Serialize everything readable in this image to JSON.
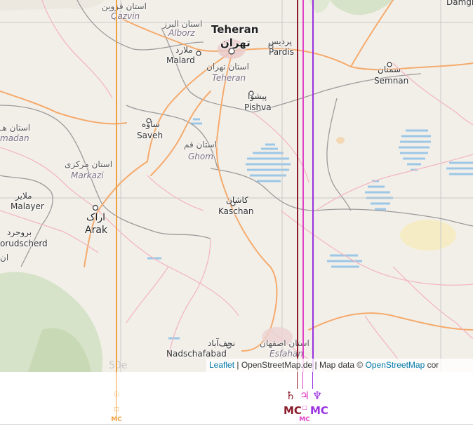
{
  "map": {
    "attribution": {
      "leaflet_link": "Leaflet",
      "sep": " | ",
      "tiles_text": "OpenStreetMap.de | Map data © ",
      "osm_link": "OpenStreetMap",
      "tail": " cor"
    },
    "grid_label": "50e",
    "places": {
      "damghan": "Damgh",
      "qazvin_fa": "استان قزوین",
      "qazvin": "Qazvin",
      "alborz_fa": "استان البرز",
      "alborz": "Alborz",
      "teheran_city": "Teheran",
      "tehran_fa": "تهران",
      "pardis_fa": "پردیس",
      "pardis": "Pardis",
      "malard_fa": "ملارد",
      "malard": "Malard",
      "tehran_prov_fa": "استان تهران",
      "teheran_prov": "Teheran",
      "semnan_fa": "سمنان",
      "semnan": "Semnan",
      "pishva_fa": "پیشوا",
      "pishva": "Pishva",
      "hamadan_fa": "استان هـ",
      "hamadan": "madan",
      "saveh_fa": "ساوه",
      "saveh": "Saveh",
      "qom_fa": "استان قم",
      "ghom": "Ghom",
      "markazi_fa": "استان مرکزی",
      "markazi": "Markazi",
      "kashan_fa": "کاشان",
      "kaschan": "Kaschan",
      "malayer_fa": "ملایر",
      "malayer": "Malayer",
      "arak_fa": "اراک",
      "arak": "Arak",
      "borujerd_fa": "بروجرد",
      "borujerd": "orudscherd",
      "lorestan_fa": "ان",
      "isfahan_fa": "استان اصفهان",
      "esfahan": "Esfahan",
      "najafabad_fa": "نجف‌آباد",
      "najafabad": "Nadschafabad"
    }
  },
  "lines": [
    {
      "planet": "Sun",
      "icon": "sun-mc-icon",
      "symbol": "☉",
      "label": "MC",
      "color": "#f0a040"
    },
    {
      "planet": "Saturn",
      "icon": "saturn-mc-icon",
      "symbol": "♄",
      "label": "MC",
      "color": "#8b1a2a"
    },
    {
      "planet": "Jupiter",
      "icon": "jupiter-mc-icon",
      "symbol": "♃",
      "label": "MC",
      "color": "#e040c8"
    },
    {
      "planet": "Neptune",
      "icon": "neptune-mc-icon",
      "symbol": "♆",
      "label": "MC",
      "color": "#9a30e0"
    }
  ]
}
